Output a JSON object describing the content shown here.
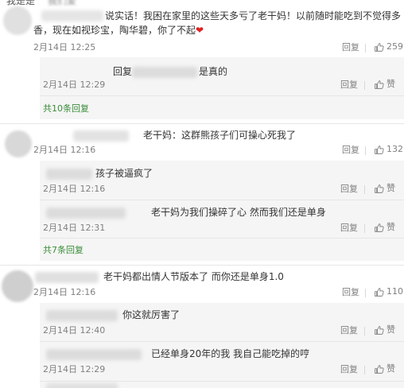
{
  "top_partial": {
    "name": "我是是",
    "handle": "我们爱"
  },
  "comments": [
    {
      "text_line1": "说实话！我困在家里的这些天多亏了老干妈！以前随时能吃到不觉得多",
      "text_line2": "香，现在如视珍宝，陶华碧，你了不起",
      "heart": "❤",
      "date": "2月14日 12:25",
      "reply_label": "回复",
      "like_count": "259",
      "replies": [
        {
          "prefix": "回复",
          "text": "是真的",
          "date": "2月14日 12:29",
          "reply_label": "回复",
          "like_label": "赞"
        }
      ],
      "more": "共10条回复"
    },
    {
      "text": "老干妈：这群熊孩子们可操心死我了",
      "date": "2月14日 12:16",
      "reply_label": "回复",
      "like_count": "132",
      "replies": [
        {
          "text": "孩子被逼疯了",
          "date": "2月14日 12:16",
          "reply_label": "回复",
          "like_label": "赞"
        },
        {
          "text": "老干妈为我们操碎了心 然而我们还是单身",
          "date": "2月14日 12:31",
          "reply_label": "回复",
          "like_label": "赞"
        }
      ],
      "more": "共7条回复"
    },
    {
      "text": "老干妈都出情人节版本了  而你还是单身1.0",
      "date": "2月14日 12:16",
      "reply_label": "回复",
      "like_count": "110",
      "replies": [
        {
          "text": "你这就厉害了",
          "date": "2月14日 12:40",
          "reply_label": "回复",
          "like_label": "赞"
        },
        {
          "text": "已经单身20年的我 我自己能吃掉的哼",
          "date": "2月14日 12:29",
          "reply_label": "回复",
          "like_label": "赞"
        }
      ]
    }
  ],
  "icons": {
    "like": "thumbs-up-icon",
    "heart": "heart-icon"
  },
  "colors": {
    "link_green": "#3a8d3a",
    "meta_gray": "#808080",
    "reply_bg": "#f5f5f5"
  }
}
